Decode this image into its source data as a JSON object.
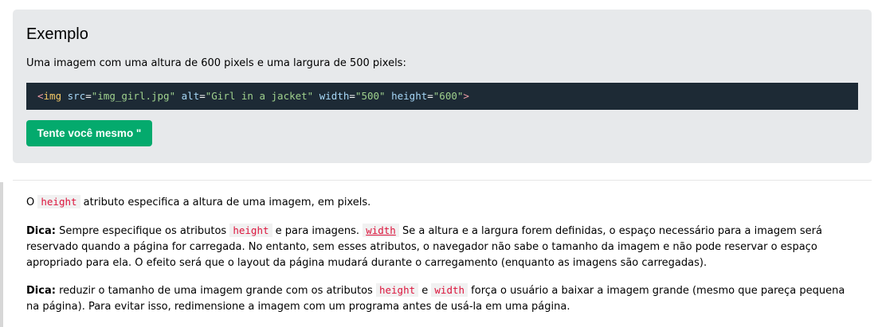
{
  "example": {
    "title": "Exemplo",
    "description": "Uma imagem com uma altura de 600 pixels e uma largura de 500 pixels:",
    "code": {
      "open": "<",
      "tag": "img",
      "attr1": "src",
      "val1": "\"img_girl.jpg\"",
      "attr2": "alt",
      "val2": "\"Girl in a jacket\"",
      "attr3": "width",
      "val3": "\"500\"",
      "attr4": "height",
      "val4": "\"600\"",
      "close": ">"
    },
    "try_button": "Tente você mesmo \""
  },
  "paragraphs": {
    "p1": {
      "before": "O ",
      "code": "height",
      "after": " atributo especifica a altura de uma imagem, em pixels."
    },
    "p2": {
      "label": "Dica:",
      "text1": " Sempre especifique os atributos ",
      "code1": "height",
      "text2": " e para imagens. ",
      "code2": "width",
      "text3": " Se a altura e a largura forem definidas, o espaço necessário para a imagem será reservado quando a página for carregada. No entanto, sem esses atributos, o navegador não sabe o tamanho da imagem e não pode reservar o espaço apropriado para ela. O efeito será que o layout da página mudará durante o carregamento (enquanto as imagens são carregadas)."
    },
    "p3": {
      "label": "Dica:",
      "text1": " reduzir o tamanho de uma imagem grande com os atributos ",
      "code1": "height",
      "text2": " e ",
      "code2": "width",
      "text3": " força o usuário a baixar a imagem grande (mesmo que pareça pequena na página). Para evitar isso, redimensione a imagem com um programa antes de usá-la em uma página."
    }
  },
  "colors": {
    "try_button": "#04aa6d",
    "code_background": "#1d2a35",
    "inline_code_text": "#dc143c",
    "example_background": "#e7e9eb"
  }
}
